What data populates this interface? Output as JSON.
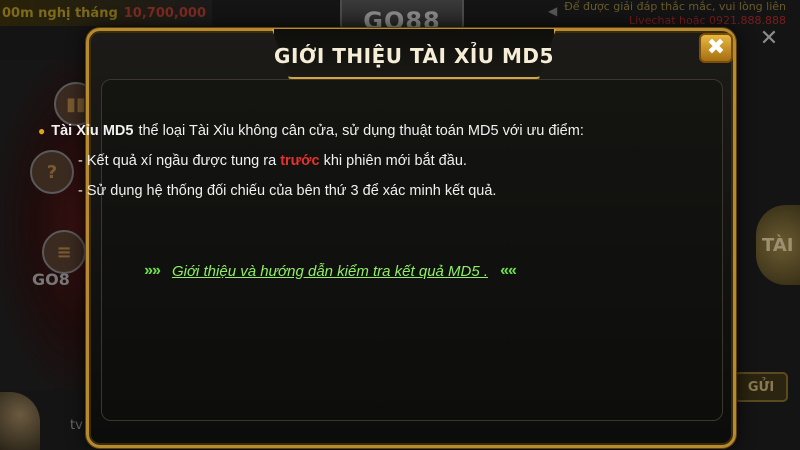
{
  "background": {
    "top_left": {
      "label": "00m nghị tháng",
      "amount": "10,700,000"
    },
    "logo": "GO88",
    "top_right": {
      "line1": "Để được giải đáp thắc mắc, vui lòng liên",
      "line2": "Livechat hoặc 0921.888.888"
    },
    "left_label": "GO8",
    "avatar_name": "tv",
    "right_badge": "TÀI",
    "send_button": "GỬI",
    "close_right": "✕"
  },
  "dialog": {
    "title": "GIỚI THIỆU TÀI XỈU MD5",
    "close_icon": "✖",
    "intro": {
      "bold": "Tài Xỉu MD5",
      "text": "thể loại Tài Xỉu không cân cửa, sử dụng thuật toán MD5 với ưu điểm:"
    },
    "bullets": [
      {
        "prefix": "- Kết quả xí ngầu được tung ra ",
        "highlight": "trước",
        "suffix": " khi phiên mới bắt đầu."
      },
      {
        "text": "- Sử dụng hệ thống đối chiếu của bên thứ 3 để xác minh kết quả."
      }
    ],
    "link": {
      "left_arrows": "»»",
      "text": "Giới thiệu và hướng dẫn kiểm tra kết quả MD5 .",
      "right_arrows": "««"
    }
  },
  "colors": {
    "gold_border": "#b88a2e",
    "highlight_red": "#e5322c",
    "link_green": "#8ff064"
  }
}
